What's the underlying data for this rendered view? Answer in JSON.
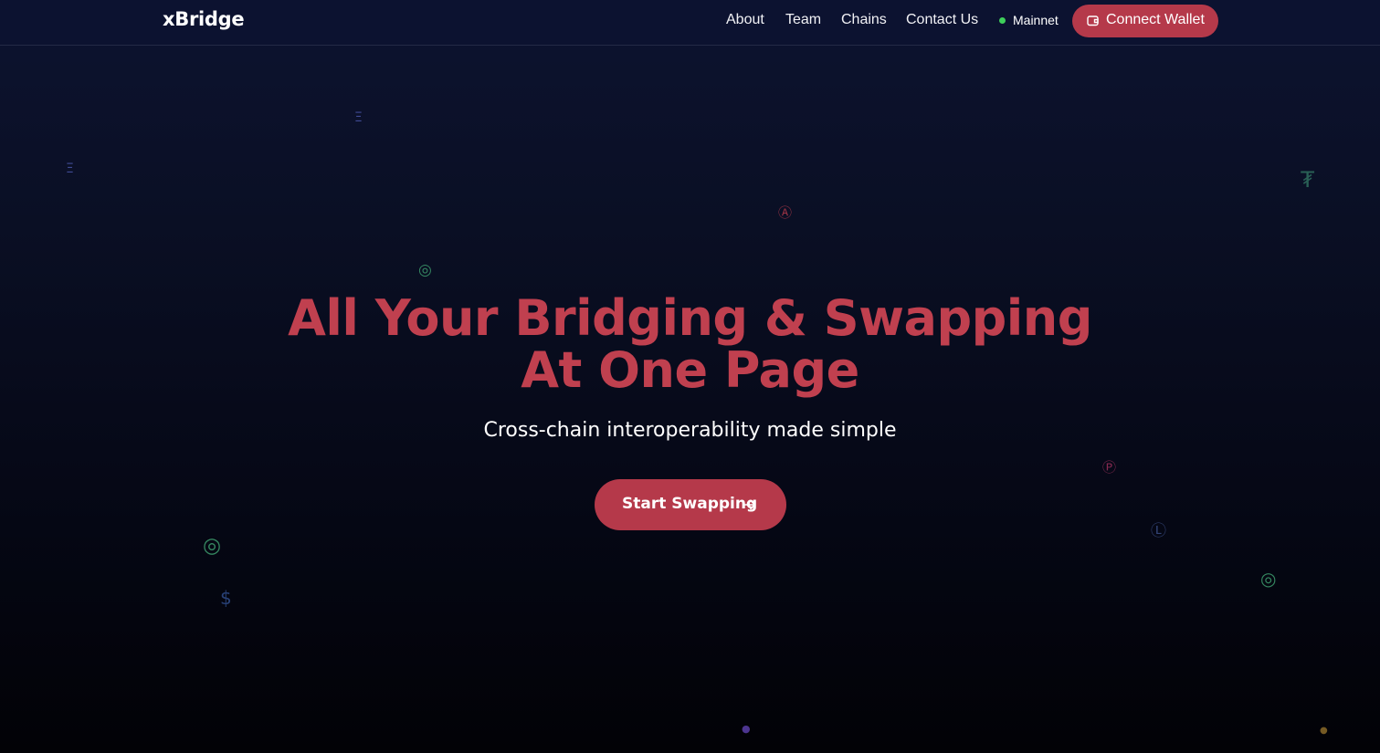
{
  "brand": "xBridge",
  "nav": {
    "links": [
      "About",
      "Team",
      "Chains",
      "Contact Us"
    ],
    "network_status": "Mainnet",
    "network_status_color": "#3ecf5a",
    "connect_label": "Connect Wallet"
  },
  "hero": {
    "title_line1": "All Your Bridging & Swapping",
    "title_line2": "At One Page",
    "subtitle": "Cross-chain interoperability made simple",
    "cta_label": "Start Swapping"
  },
  "colors": {
    "accent": "#b5394a",
    "accent_text": "#c0404f",
    "nav_bg": "#0c1230",
    "page_bg_top": "#0d1330",
    "page_bg_bottom": "#020206"
  },
  "floating_icons": [
    {
      "name": "ethereum-icon",
      "glyph": "Ξ",
      "color": "#4a56a8"
    },
    {
      "name": "ethereum-icon",
      "glyph": "Ξ",
      "color": "#4a56a8"
    },
    {
      "name": "tether-icon",
      "glyph": "₮",
      "color": "#2f6f5e"
    },
    {
      "name": "arbitrum-icon",
      "glyph": "Ⓐ",
      "color": "#b5394a"
    },
    {
      "name": "optimism-icon",
      "glyph": "◎",
      "color": "#3e9e6e"
    },
    {
      "name": "polygon-icon",
      "glyph": "Ⓟ",
      "color": "#a0305c"
    },
    {
      "name": "litecoin-icon",
      "glyph": "Ⓛ",
      "color": "#3b4e86"
    },
    {
      "name": "optimism-icon",
      "glyph": "◎",
      "color": "#3e9e6e"
    },
    {
      "name": "optimism-icon",
      "glyph": "◎",
      "color": "#3e9e6e"
    },
    {
      "name": "dollar-icon",
      "glyph": "$",
      "color": "#2f4c8a"
    },
    {
      "name": "token-icon",
      "glyph": "●",
      "color": "#5a3ea8"
    },
    {
      "name": "token-icon",
      "glyph": "●",
      "color": "#8a6a2a"
    }
  ]
}
